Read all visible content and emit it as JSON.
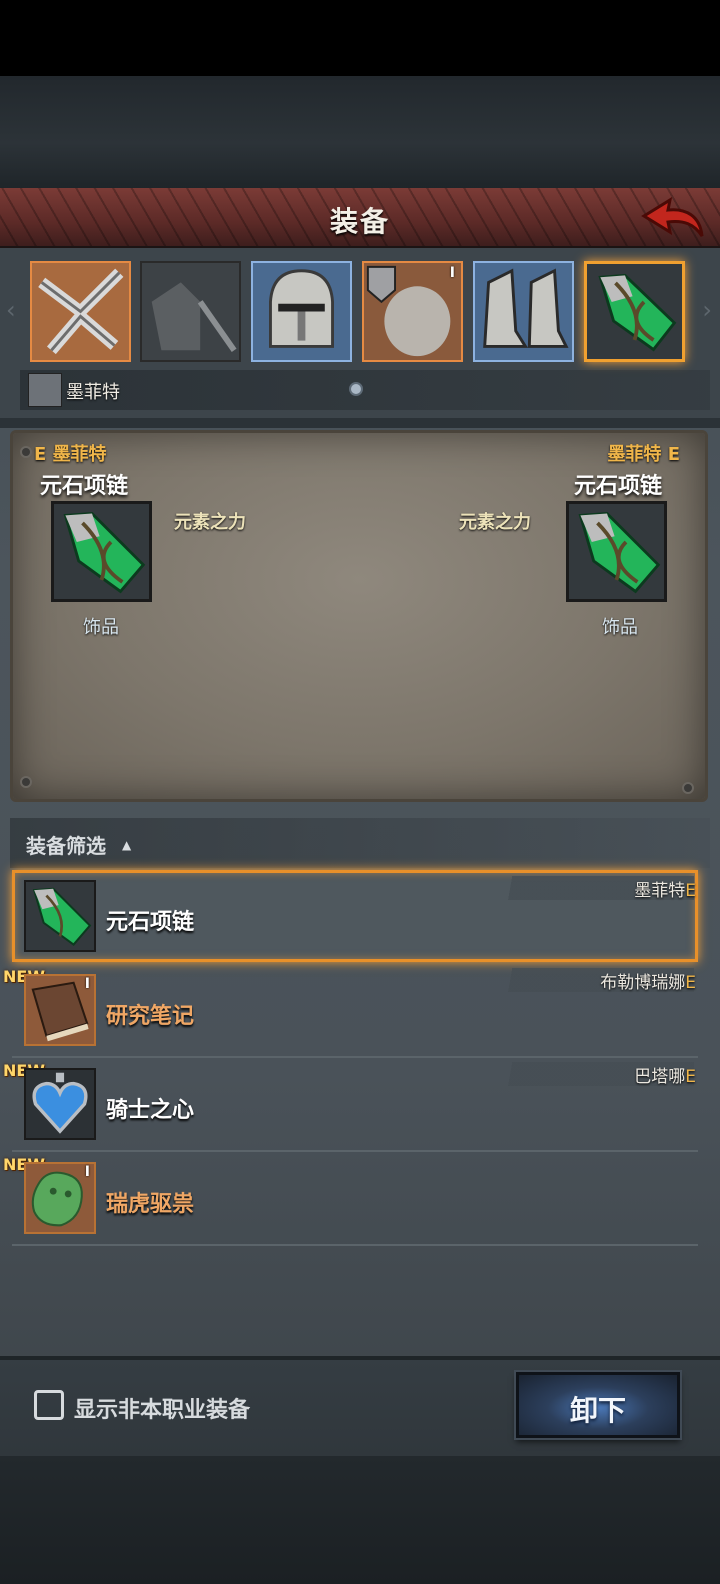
{
  "header": {
    "title": "装备"
  },
  "icons": {
    "back": "back-arrow-icon",
    "slots": [
      "weapon-icon",
      "armor-icon",
      "helmet-icon",
      "accessory-icon",
      "boots-icon",
      "necklace-icon"
    ]
  },
  "hero": {
    "name": "墨菲特"
  },
  "compare": {
    "left": {
      "owner": "E 墨菲特",
      "name": "元石项链",
      "attr": "元素之力",
      "type": "饰品"
    },
    "right": {
      "owner": "墨菲特 E",
      "name": "元石项链",
      "attr": "元素之力",
      "type": "饰品"
    }
  },
  "filter": {
    "label": "装备筛选",
    "caret": "▲"
  },
  "items": [
    {
      "name": "元石项链",
      "owner": "墨菲特",
      "owner_suffix": "E",
      "new": "",
      "tier": "",
      "selected": true
    },
    {
      "name": "研究笔记",
      "owner": "布勒博瑞娜",
      "owner_suffix": "E",
      "new": "NEW",
      "tier": "I",
      "selected": false
    },
    {
      "name": "骑士之心",
      "owner": "巴塔哪",
      "owner_suffix": "E",
      "new": "NEW",
      "tier": "",
      "selected": false
    },
    {
      "name": "瑞虎驱祟",
      "owner": "",
      "owner_suffix": "",
      "new": "NEW",
      "tier": "I",
      "selected": false
    }
  ],
  "slot_tier_label": "I",
  "footer": {
    "checkbox_label": "显示非本职业装备",
    "checkbox_checked": false,
    "unequip_label": "卸下"
  },
  "colors": {
    "accent_orange": "#e8902a",
    "owner_gold": "#f0b64a",
    "button_blue": "#4a77b6"
  }
}
